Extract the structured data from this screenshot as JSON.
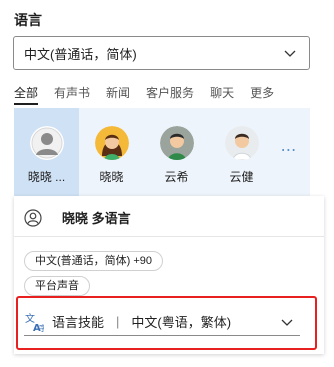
{
  "section_label": "语言",
  "language_select": {
    "value": "中文(普通话，简体)",
    "icon": "chevron-down-icon"
  },
  "tabs": [
    {
      "label": "全部",
      "active": true
    },
    {
      "label": "有声书",
      "active": false
    },
    {
      "label": "新闻",
      "active": false
    },
    {
      "label": "客户服务",
      "active": false
    },
    {
      "label": "聊天",
      "active": false
    },
    {
      "label": "更多",
      "active": false
    }
  ],
  "voices": [
    {
      "name": "晓晓 ...",
      "avatar": "generic-avatar",
      "selected": true
    },
    {
      "name": "晓晓",
      "avatar": "female-avatar",
      "selected": false
    },
    {
      "name": "云希",
      "avatar": "male-avatar",
      "selected": false
    },
    {
      "name": "云健",
      "avatar": "male-avatar-2",
      "selected": false
    }
  ],
  "voices_more_icon": "more-horizontal-icon",
  "voice_card": {
    "title": "晓晓 多语言",
    "icon": "person-icon",
    "chips": [
      "中文(普通话，简体) +90",
      "平台声音"
    ]
  },
  "language_skill": {
    "label": "语言技能",
    "separator": "|",
    "value": "中文(粤语，繁体)",
    "icon": "translate-icon",
    "highlight_color": "#e8201f"
  },
  "colors": {
    "accent": "#5b8fc9",
    "voice_strip_bg": "#eef4fb",
    "voice_selected_bg": "#cfe1f5"
  }
}
